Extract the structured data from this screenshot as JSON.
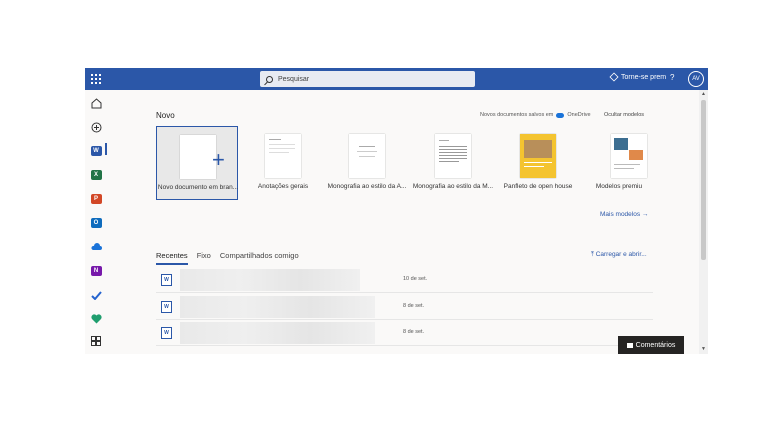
{
  "search": {
    "placeholder": "Pesquisar"
  },
  "header": {
    "premium": "Torne-se prem",
    "help": "?",
    "avatar": "AV"
  },
  "rail": {
    "apps": [
      {
        "name": "home",
        "color": "#444"
      },
      {
        "name": "create",
        "color": "#444"
      },
      {
        "name": "word",
        "color": "#2b57a8",
        "letter": "W"
      },
      {
        "name": "excel",
        "color": "#217346",
        "letter": "X"
      },
      {
        "name": "powerpoint",
        "color": "#d24726",
        "letter": "P"
      },
      {
        "name": "outlook",
        "color": "#0f6cbd",
        "letter": "O"
      },
      {
        "name": "onedrive",
        "color": "#1a73d9",
        "letter": ""
      },
      {
        "name": "onenote",
        "color": "#7719aa",
        "letter": "N"
      },
      {
        "name": "todo",
        "color": "#2564cf",
        "letter": ""
      },
      {
        "name": "family-safety",
        "color": "#1f9e6e",
        "letter": ""
      },
      {
        "name": "all-apps",
        "color": "#444",
        "letter": ""
      }
    ]
  },
  "novo": {
    "heading": "Novo",
    "saved_in_prefix": "Novos documentos salvos em",
    "saved_in_service": "OneDrive",
    "hide_models": "Ocultar modelos",
    "templates": [
      "Novo documento em bran...",
      "Anotações gerais",
      "Monografia ao estilo da A...",
      "Monografia ao estilo da M...",
      "Panfleto de open house",
      "Modelos premiu"
    ],
    "more_models": "Mais modelos"
  },
  "files": {
    "tabs": [
      "Recentes",
      "Fixo",
      "Compartilhados comigo"
    ],
    "upload": "Carregar e abrir...",
    "rows": [
      {
        "date": "10 de set."
      },
      {
        "date": "8 de set."
      },
      {
        "date": "8 de set."
      }
    ]
  },
  "feedback": {
    "label": "Comentários"
  }
}
